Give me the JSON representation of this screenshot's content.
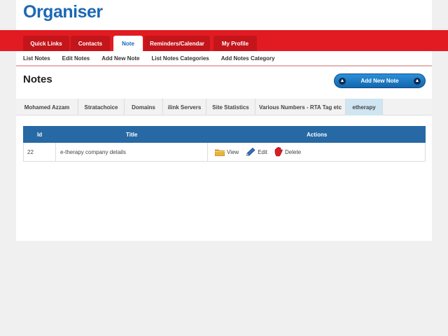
{
  "app": {
    "logo": "Organiser"
  },
  "main_tabs": [
    {
      "label": "Quick Links",
      "active": false
    },
    {
      "label": "Contacts",
      "active": false
    },
    {
      "label": "Note",
      "active": true
    },
    {
      "label": "Reminders/Calendar",
      "active": false
    },
    {
      "label": "My Profile",
      "active": false
    }
  ],
  "sub_nav": [
    {
      "label": "List Notes"
    },
    {
      "label": "Edit Notes"
    },
    {
      "label": "Add New Note"
    },
    {
      "label": "List Notes Categories"
    },
    {
      "label": "Add Notes Category"
    }
  ],
  "page": {
    "title": "Notes",
    "add_button": "Add New Note"
  },
  "categories": [
    {
      "label": "Mohamed Azzam",
      "active": false
    },
    {
      "label": "Stratachoice",
      "active": false
    },
    {
      "label": "Domains",
      "active": false
    },
    {
      "label": "ilink Servers",
      "active": false
    },
    {
      "label": "Site Statistics",
      "active": false
    },
    {
      "label": "Various Numbers - RTA Tag etc",
      "active": false
    },
    {
      "label": "etherapy",
      "active": true
    }
  ],
  "table": {
    "columns": {
      "id": "Id",
      "title": "Title",
      "actions": "Actions"
    },
    "rows": [
      {
        "id": "22",
        "title": "e-therapy company details"
      }
    ],
    "actions": {
      "view": "View",
      "edit": "Edit",
      "delete": "Delete"
    }
  },
  "colors": {
    "brand_blue": "#1b68b5",
    "nav_red": "#e21b22",
    "table_header": "#2669a4"
  }
}
